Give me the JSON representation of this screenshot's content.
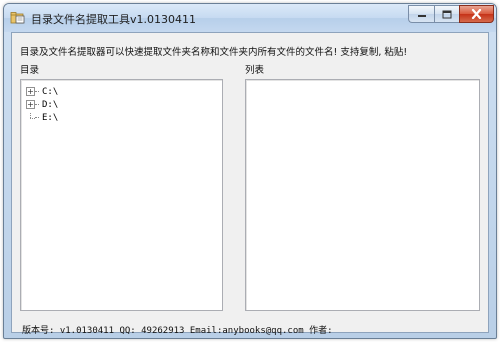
{
  "window": {
    "title": "目录文件名提取工具v1.0130411",
    "icons": {
      "app": "folder-tool-icon",
      "minimize": "minimize-icon",
      "maximize": "maximize-icon",
      "close": "close-icon"
    },
    "colors": {
      "close_button": "#c53218",
      "titlebar": "#c6daf1"
    }
  },
  "main": {
    "description": "目录及文件名提取器可以快速提取文件夹名称和文件夹内所有文件的文件名! 支持复制, 粘贴!",
    "directory_label": "目录",
    "list_label": "列表",
    "tree": {
      "items": [
        {
          "label": "C:\\",
          "expandable": true
        },
        {
          "label": "D:\\",
          "expandable": true
        },
        {
          "label": "E:\\",
          "expandable": false
        }
      ]
    },
    "list": {
      "items": []
    }
  },
  "status": {
    "text": "版本号: v1.0130411 QQ: 49262913  Email:anybooks@qq.com 作者:"
  }
}
